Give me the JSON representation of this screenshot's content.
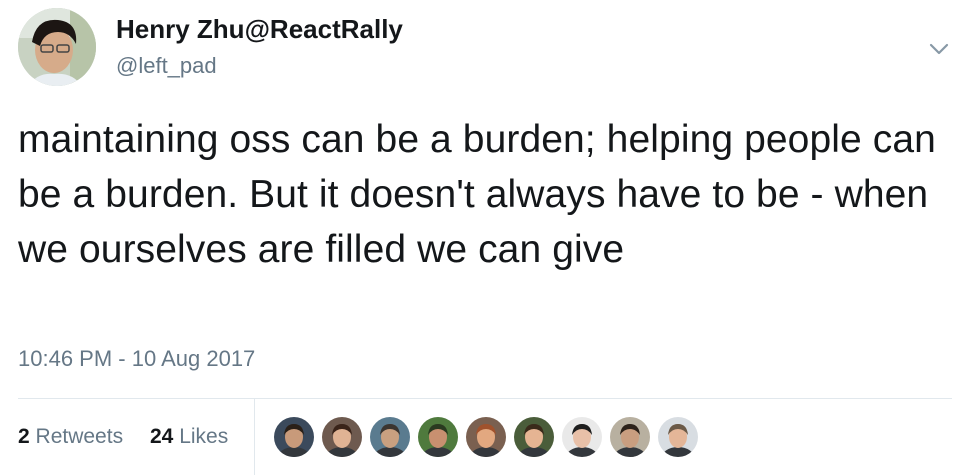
{
  "tweet": {
    "author_name": "Henry Zhu@ReactRally",
    "author_handle": "@left_pad",
    "text": "maintaining oss can be a burden; helping people can be a burden. But it doesn't always have to be - when we ourselves are filled we can give",
    "timestamp": "10:46 PM - 10 Aug 2017",
    "retweets_count": "2",
    "retweets_label": "Retweets",
    "likes_count": "24",
    "likes_label": "Likes"
  },
  "icons": {
    "menu": "chevron-down-icon",
    "avatar": "avatar"
  },
  "likers": [
    {
      "name": "liker-avatar-1",
      "bg": "#3b4a5c",
      "skin": "#c89a7a",
      "hair": "#2a2018"
    },
    {
      "name": "liker-avatar-2",
      "bg": "#6e5a4f",
      "skin": "#e0b394",
      "hair": "#3a241a"
    },
    {
      "name": "liker-avatar-3",
      "bg": "#5a7b8f",
      "skin": "#c9a080",
      "hair": "#3b3530"
    },
    {
      "name": "liker-avatar-4",
      "bg": "#4f7a3d",
      "skin": "#c89070",
      "hair": "#2a3a20"
    },
    {
      "name": "liker-avatar-5",
      "bg": "#7a6050",
      "skin": "#e2a880",
      "hair": "#a0522d"
    },
    {
      "name": "liker-avatar-6",
      "bg": "#4a5d3a",
      "skin": "#e5b493",
      "hair": "#3a2a1a"
    },
    {
      "name": "liker-avatar-7",
      "bg": "#e9e9e9",
      "skin": "#e8c0a8",
      "hair": "#1e1e1e"
    },
    {
      "name": "liker-avatar-8",
      "bg": "#b8b0a0",
      "skin": "#c99e80",
      "hair": "#2b2119"
    },
    {
      "name": "liker-avatar-9",
      "bg": "#d8dde2",
      "skin": "#e4b698",
      "hair": "#6b5a48"
    }
  ],
  "colors": {
    "text_primary": "#14171a",
    "text_secondary": "#657786",
    "divider": "#e1e8ed"
  }
}
